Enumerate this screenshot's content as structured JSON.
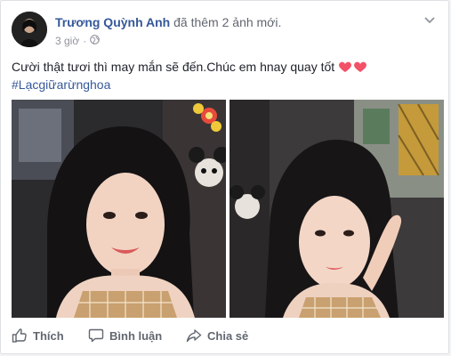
{
  "post": {
    "author": "Trương Quỳnh Anh",
    "action": "đã thêm 2 ảnh mới.",
    "time": "3 giờ",
    "privacy_icon": "globe-icon",
    "text": "Cười thật tươi thì may mắn sẽ đến.Chúc em hnay quay tốt",
    "hashtag": "#Lạcgiữarừnghoa",
    "emoji": [
      "heart-icon",
      "heart-icon"
    ],
    "accent_color": "#365899",
    "heart_color": "#f25268"
  },
  "actions": {
    "like": "Thích",
    "comment": "Bình luận",
    "share": "Chia sẻ"
  }
}
